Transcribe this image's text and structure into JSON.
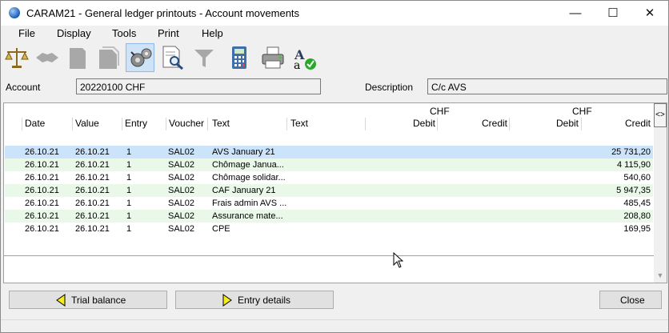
{
  "window": {
    "title": "CARAM21 - General ledger printouts - Account movements",
    "minimize": "—",
    "maximize": "☐",
    "close": "✕"
  },
  "menu": [
    "File",
    "Display",
    "Tools",
    "Print",
    "Help"
  ],
  "toolbar": {
    "icons": [
      "scales-icon",
      "open-book-icon",
      "document-icon",
      "document-stack-icon",
      "settings-gears-icon",
      "print-preview-icon",
      "funnel-icon",
      "calculator-icon",
      "printer-icon",
      "spell-check-icon"
    ],
    "active": "settings-gears-icon"
  },
  "account": {
    "label": "Account",
    "value": "20220100 CHF"
  },
  "description": {
    "label": "Description",
    "value": "C/c AVS"
  },
  "grid": {
    "headers": {
      "date": "Date",
      "value": "Value",
      "entry": "Entry",
      "voucher": "Voucher",
      "text": "Text",
      "text2": "Text",
      "currency1": "CHF",
      "debit1": "Debit",
      "credit1": "Credit",
      "currency2": "CHF",
      "debit2": "Debit",
      "credit2": "Credit"
    },
    "rows": [
      {
        "date": "26.10.21",
        "value": "26.10.21",
        "entry": "1",
        "voucher": "SAL02",
        "text": "AVS January 21",
        "credit": "25 731,20"
      },
      {
        "date": "26.10.21",
        "value": "26.10.21",
        "entry": "1",
        "voucher": "SAL02",
        "text": "Chômage Janua...",
        "credit": "4 115,90"
      },
      {
        "date": "26.10.21",
        "value": "26.10.21",
        "entry": "1",
        "voucher": "SAL02",
        "text": "Chômage solidar...",
        "credit": "540,60"
      },
      {
        "date": "26.10.21",
        "value": "26.10.21",
        "entry": "1",
        "voucher": "SAL02",
        "text": "CAF January 21",
        "credit": "5 947,35"
      },
      {
        "date": "26.10.21",
        "value": "26.10.21",
        "entry": "1",
        "voucher": "SAL02",
        "text": "Frais admin AVS ...",
        "credit": "485,45"
      },
      {
        "date": "26.10.21",
        "value": "26.10.21",
        "entry": "1",
        "voucher": "SAL02",
        "text": "Assurance mate...",
        "credit": "208,80"
      },
      {
        "date": "26.10.21",
        "value": "26.10.21",
        "entry": "1",
        "voucher": "SAL02",
        "text": "CPE",
        "credit": "169,95"
      }
    ],
    "scroll_toggle": "<>"
  },
  "buttons": {
    "trial_balance": "Trial balance",
    "entry_details": "Entry details",
    "close": "Close"
  },
  "colors": {
    "selected_row": "#cce4fb",
    "alternate_row": "#e9f8e9",
    "button_arrow": "#f5ec1c"
  }
}
